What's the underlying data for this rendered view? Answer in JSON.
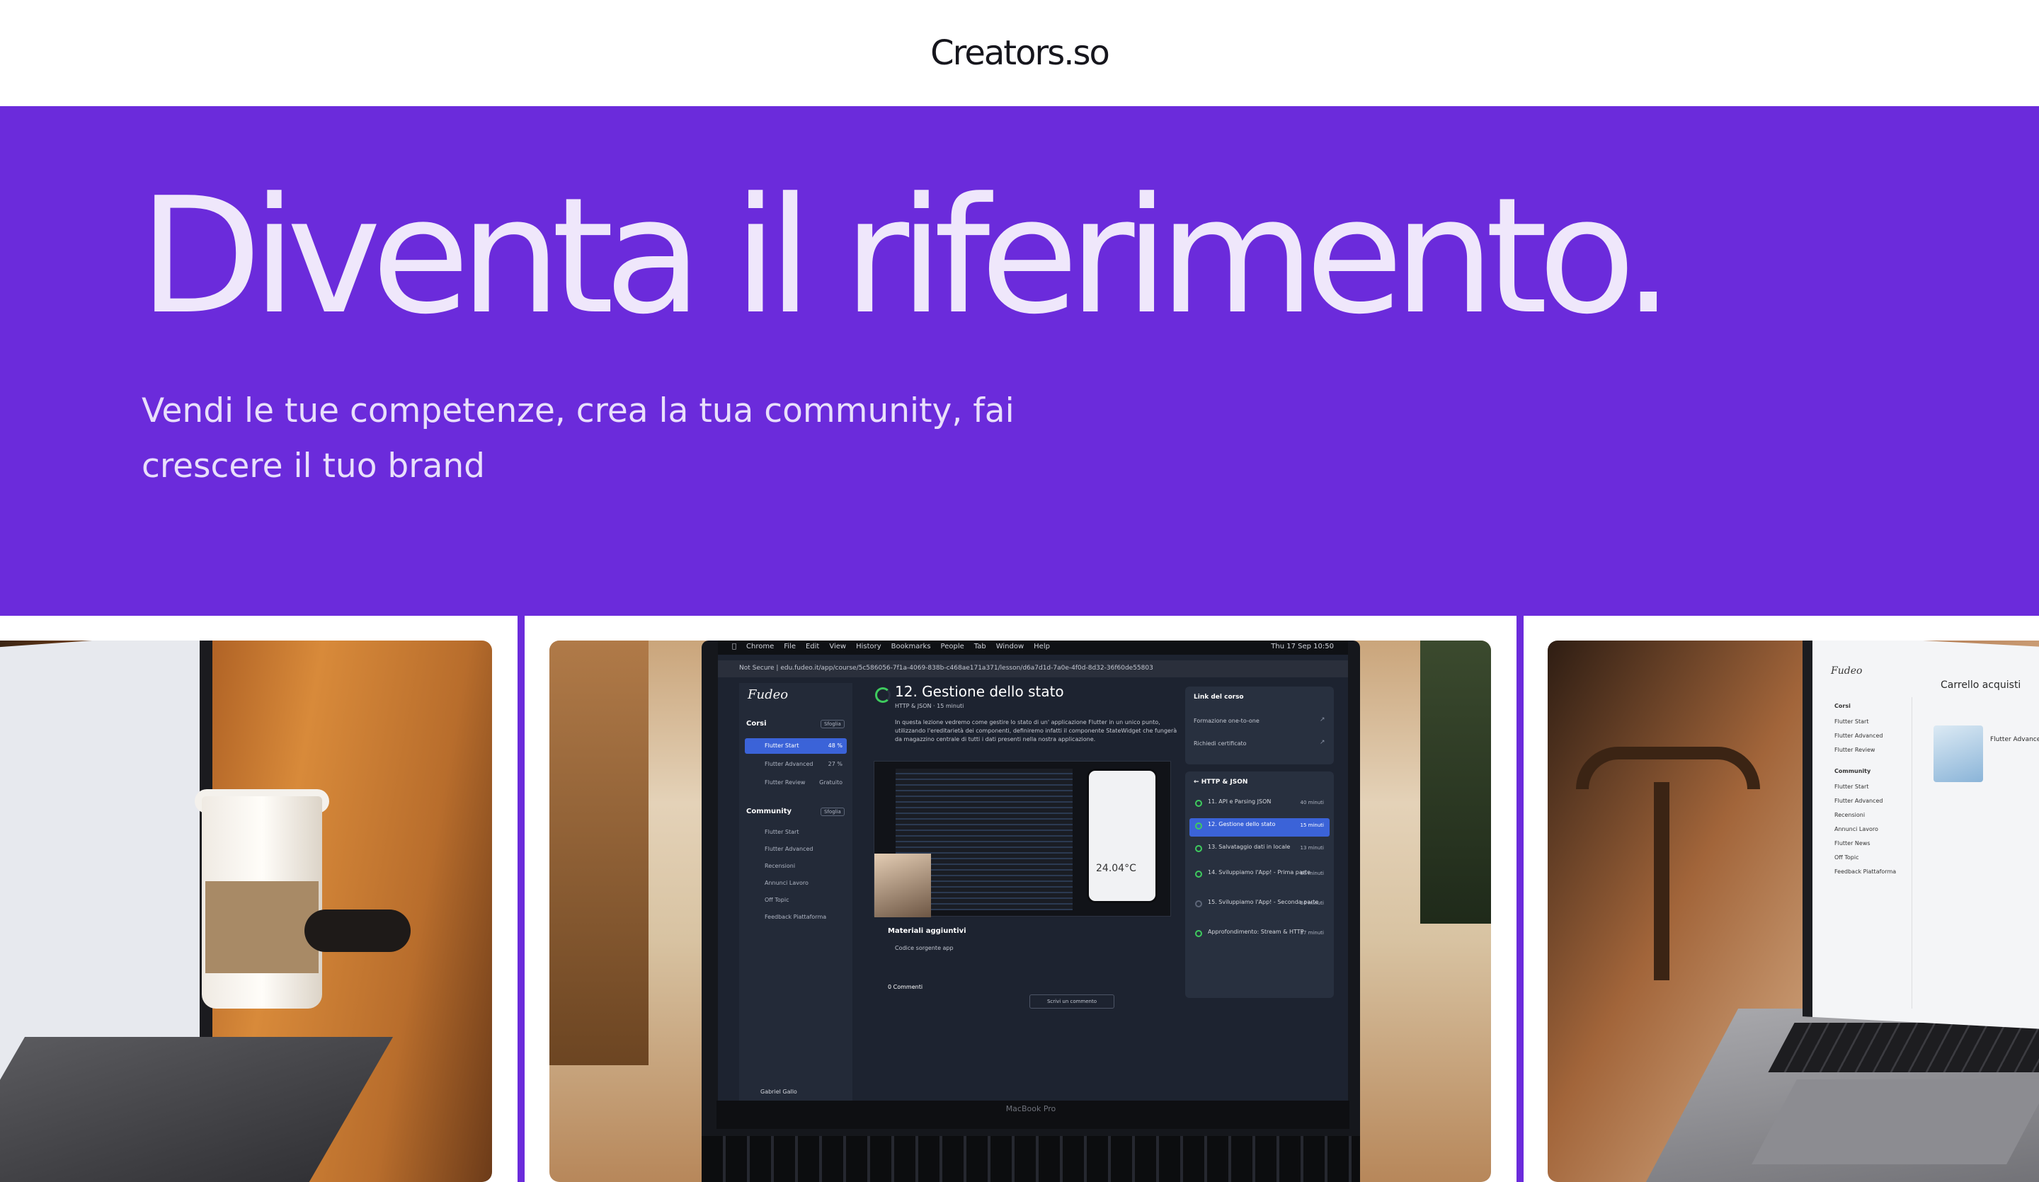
{
  "header": {
    "logo": "Creators.so"
  },
  "hero": {
    "title": "Diventa il riferimento.",
    "subtitle": "Vendi le tue competenze, crea la tua community, fai crescere il tuo brand"
  },
  "colors": {
    "brand_purple": "#6b2bdb",
    "hero_text": "#efe7fb",
    "logo_text": "#16161d"
  },
  "gallery": {
    "center": {
      "menubar": [
        "Chrome",
        "File",
        "Edit",
        "View",
        "History",
        "Bookmarks",
        "People",
        "Tab",
        "Window",
        "Help"
      ],
      "clock": "Thu 17 Sep 10:50",
      "url": "Not Secure | edu.fudeo.it/app/course/5c586056-7f1a-4069-838b-c468ae171a371/lesson/d6a7d1d-7a0e-4f0d-8d32-36f60de55803",
      "brand": "Fudeo",
      "sidebar": {
        "courses_heading": "Corsi",
        "courses_button": "Sfoglia",
        "courses": [
          {
            "label": "Flutter Start",
            "value": "48 %",
            "active": true
          },
          {
            "label": "Flutter Advanced",
            "value": "27 %",
            "active": false
          },
          {
            "label": "Flutter Review",
            "value": "Gratuito",
            "active": false
          }
        ],
        "community_heading": "Community",
        "community_button": "Sfoglia",
        "community": [
          "Flutter Start",
          "Flutter Advanced",
          "Recensioni",
          "Annunci Lavoro",
          "Off Topic",
          "Feedback Piattaforma"
        ],
        "user": "Gabriel Gallo"
      },
      "lesson": {
        "title": "12. Gestione dello stato",
        "meta": "HTTP & JSON  ·  15 minuti",
        "progress": "71%",
        "description": "In questa lezione vedremo come gestire lo stato di un' applicazione Flutter in un unico punto, utilizzando l'ereditarietà dei componenti, definiremo infatti il componente StateWidget che fungerà da magazzino centrale di tutti i dati presenti nella nostra applicazione.",
        "phone_temperature": "24.04°C",
        "materials_heading": "Materiali aggiuntivi",
        "materials_link": "Codice sorgente app",
        "comments": "0 Commenti",
        "comment_button": "Scrivi un commento"
      },
      "right_panel": {
        "links_heading": "Link del corso",
        "links": [
          "Formazione one-to-one",
          "Richiedi certificato"
        ],
        "chapter_heading": "HTTP & JSON",
        "chapters": [
          {
            "label": "11. API e Parsing JSON",
            "duration": "40 minuti",
            "active": false
          },
          {
            "label": "12. Gestione dello stato",
            "duration": "15 minuti",
            "active": true
          },
          {
            "label": "13. Salvataggio dati in locale",
            "duration": "13 minuti",
            "active": false
          },
          {
            "label": "14. Sviluppiamo l'App! - Prima parte",
            "duration": "68 minuti",
            "active": false
          },
          {
            "label": "15. Sviluppiamo l'App! - Seconda parte",
            "duration": "34 minuti",
            "active": false
          },
          {
            "label": "Approfondimento: Stream & HTTP",
            "duration": "57 minuti",
            "active": false
          }
        ]
      },
      "laptop_label": "MacBook Pro"
    },
    "right": {
      "brand": "Fudeo",
      "cart_title": "Carrello acquisti",
      "sidebar": [
        "Corsi",
        "Flutter Start",
        "Flutter Advanced",
        "Flutter Review",
        "Community",
        "Flutter Start",
        "Flutter Advanced",
        "Recensioni",
        "Annunci Lavoro",
        "Flutter News",
        "Off Topic",
        "Feedback Piattaforma"
      ],
      "product": "Flutter Advanced"
    }
  }
}
